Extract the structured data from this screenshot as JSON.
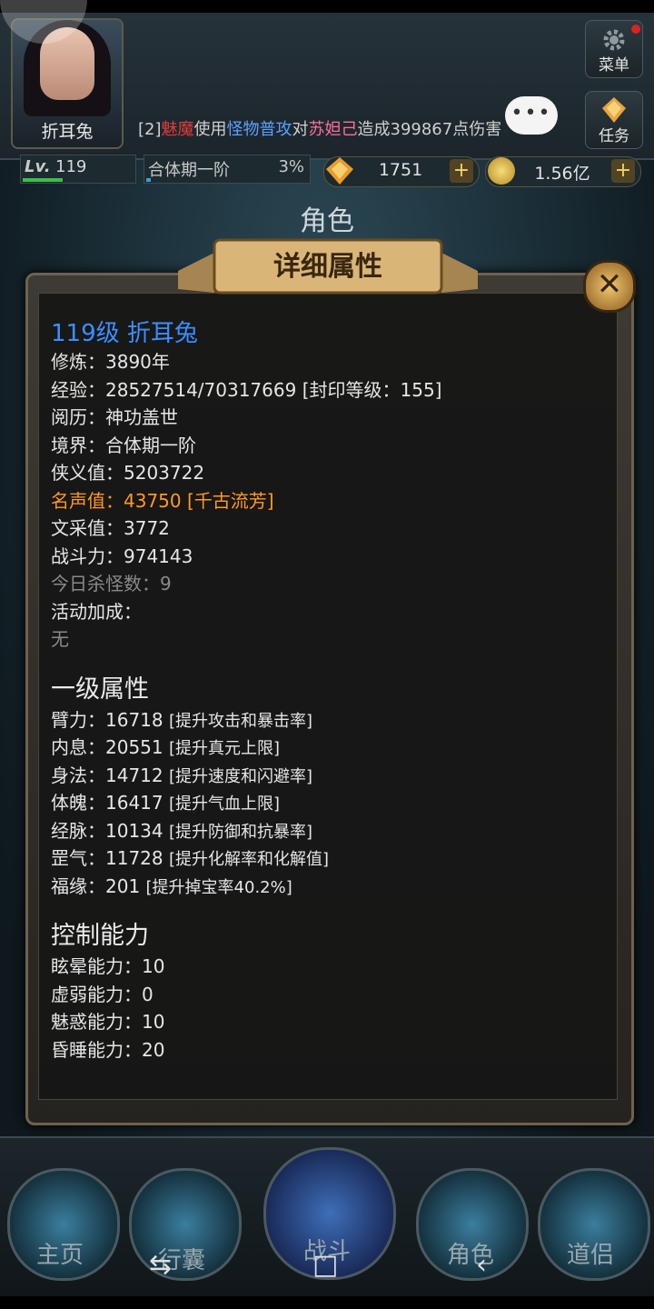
{
  "header": {
    "player_name": "折耳兔",
    "menu_label": "菜单",
    "task_label": "任务",
    "battle_log": {
      "prefix": "[2]",
      "attacker": "魅魔",
      "verb": "使用",
      "skill": "怪物普攻",
      "to": "对",
      "target": "苏妲己",
      "result": "造成399867点伤害"
    },
    "chat_dots": "•••",
    "level_label": "Lv.",
    "level": "119",
    "realm": "合体期一阶",
    "realm_progress": "3%",
    "gems": "1751",
    "gold": "1.56亿",
    "plus": "+"
  },
  "page_title": "角色",
  "panel": {
    "banner": "详细属性",
    "close": "✕",
    "title_line": "119级 折耳兔",
    "basic": [
      "修炼：3890年",
      "经验：28527514/70317669 [封印等级：155]",
      "阅历：神功盖世",
      "境界：合体期一阶",
      "侠义值：5203722"
    ],
    "fame": "名声值：43750 [千古流芳]",
    "basic2": [
      "文采值：3772",
      "战斗力：974143"
    ],
    "kills_today": "今日杀怪数：9",
    "activity_label": "活动加成：",
    "activity_value": "无",
    "primary_title": "一级属性",
    "primary": [
      {
        "name": "臂力：16718 ",
        "note": "[提升攻击和暴击率]"
      },
      {
        "name": "内息：20551 ",
        "note": "[提升真元上限]"
      },
      {
        "name": "身法：14712 ",
        "note": "[提升速度和闪避率]"
      },
      {
        "name": "体魄：16417 ",
        "note": "[提升气血上限]"
      },
      {
        "name": "经脉：10134 ",
        "note": "[提升防御和抗暴率]"
      },
      {
        "name": "罡气：11728 ",
        "note": "[提升化解率和化解值]"
      },
      {
        "name": "福缘：201 ",
        "note": "[提升掉宝率40.2%]"
      }
    ],
    "control_title": "控制能力",
    "control": [
      "眩晕能力：10",
      "虚弱能力：0",
      "魅惑能力：10",
      "昏睡能力：20"
    ]
  },
  "nav": {
    "home": "主页",
    "bag": "行囊",
    "battle": "战斗",
    "role": "角色",
    "companion": "道侣"
  },
  "colors": {
    "title_blue": "#3b8fff",
    "fame_orange": "#ff9a1f",
    "log_red": "#e23b3b",
    "log_blue": "#5fa0ff"
  }
}
